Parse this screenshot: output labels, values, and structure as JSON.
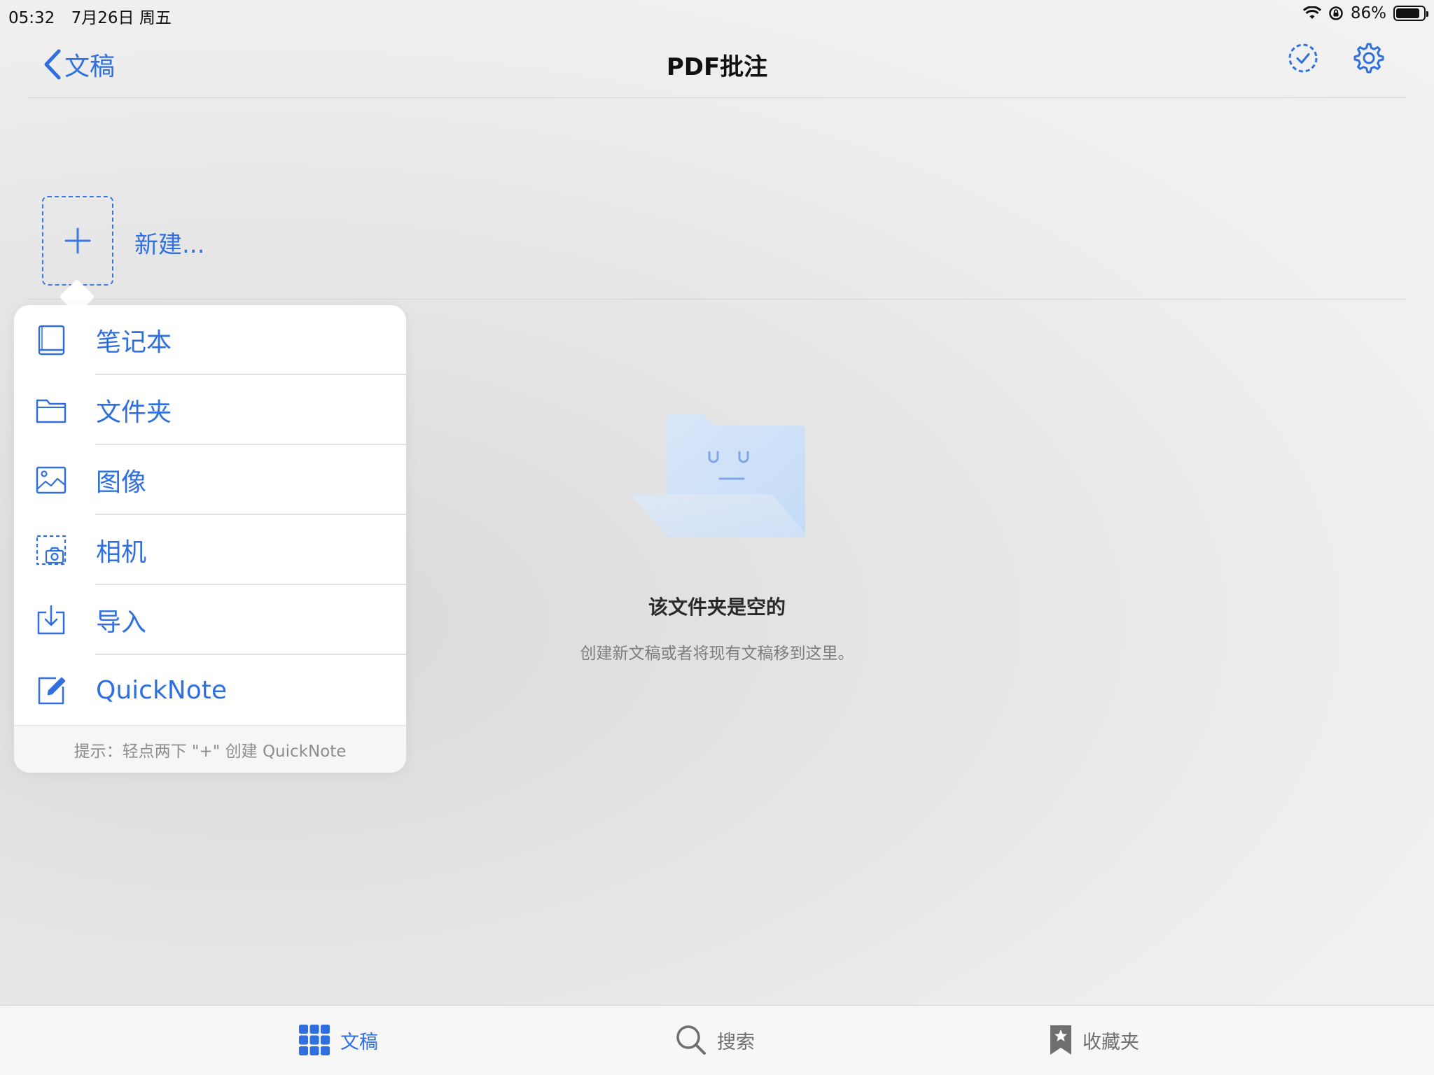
{
  "status_bar": {
    "time": "05:32",
    "date": "7月26日 周五",
    "battery_text": "86%",
    "battery_level": 0.86
  },
  "nav": {
    "back_label": "文稿",
    "title": "PDF批注"
  },
  "new_item": {
    "label": "新建..."
  },
  "popover": {
    "items": [
      {
        "label": "笔记本",
        "icon": "notebook-icon"
      },
      {
        "label": "文件夹",
        "icon": "folder-icon"
      },
      {
        "label": "图像",
        "icon": "image-icon"
      },
      {
        "label": "相机",
        "icon": "camera-icon"
      },
      {
        "label": "导入",
        "icon": "import-icon"
      },
      {
        "label": "QuickNote",
        "icon": "quicknote-icon"
      }
    ],
    "hint": "提示：轻点两下 \"+\" 创建 QuickNote"
  },
  "empty_state": {
    "title": "该文件夹是空的",
    "subtitle": "创建新文稿或者将现有文稿移到这里。"
  },
  "tab_bar": {
    "tabs": [
      {
        "label": "文稿",
        "icon": "grid-icon",
        "active": true
      },
      {
        "label": "搜索",
        "icon": "search-icon",
        "active": false
      },
      {
        "label": "收藏夹",
        "icon": "bookmark-star-icon",
        "active": false
      }
    ]
  },
  "colors": {
    "accent": "#2f6fe0",
    "background": "#f2f2f2",
    "folder_art": "#cfe1f7"
  }
}
